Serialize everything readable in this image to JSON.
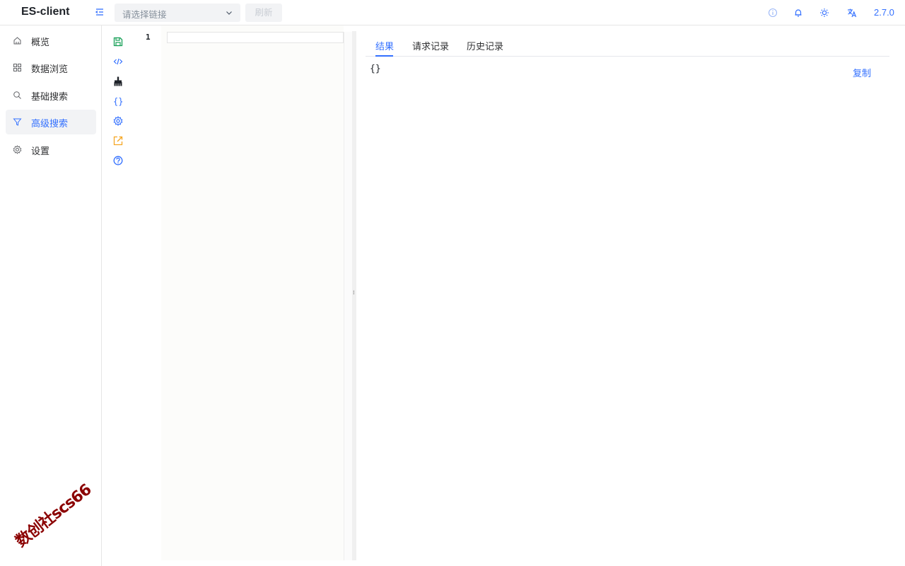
{
  "app": {
    "title": "ES-client",
    "version": "2.7.0"
  },
  "header": {
    "connection_select": {
      "placeholder": "请选择链接"
    },
    "refresh_label": "刷新",
    "icons": [
      "collapse-menu-icon",
      "info-icon",
      "bell-icon",
      "sun-icon",
      "translate-icon"
    ]
  },
  "sidebar": {
    "items": [
      {
        "label": "概览",
        "icon": "home-icon",
        "active": false
      },
      {
        "label": "数据浏览",
        "icon": "grid-icon",
        "active": false
      },
      {
        "label": "基础搜索",
        "icon": "search-icon",
        "active": false
      },
      {
        "label": "高级搜索",
        "icon": "filter-icon",
        "active": true
      },
      {
        "label": "设置",
        "icon": "gear-icon",
        "active": false
      }
    ],
    "watermark": "数创社scs66"
  },
  "toolbar": {
    "icons": [
      "save-icon",
      "code-icon",
      "clear-brush-icon",
      "format-braces-icon",
      "settings-icon",
      "external-link-icon",
      "help-icon"
    ]
  },
  "editor": {
    "line_numbers": [
      "1"
    ]
  },
  "result": {
    "tabs": [
      {
        "label": "结果",
        "active": true
      },
      {
        "label": "请求记录",
        "active": false
      },
      {
        "label": "历史记录",
        "active": false
      }
    ],
    "output": "{}",
    "copy_label": "复制"
  },
  "colors": {
    "accent": "#3370ff",
    "save": "#18a058",
    "external": "#f5a623",
    "watermark": "#8b0000"
  }
}
